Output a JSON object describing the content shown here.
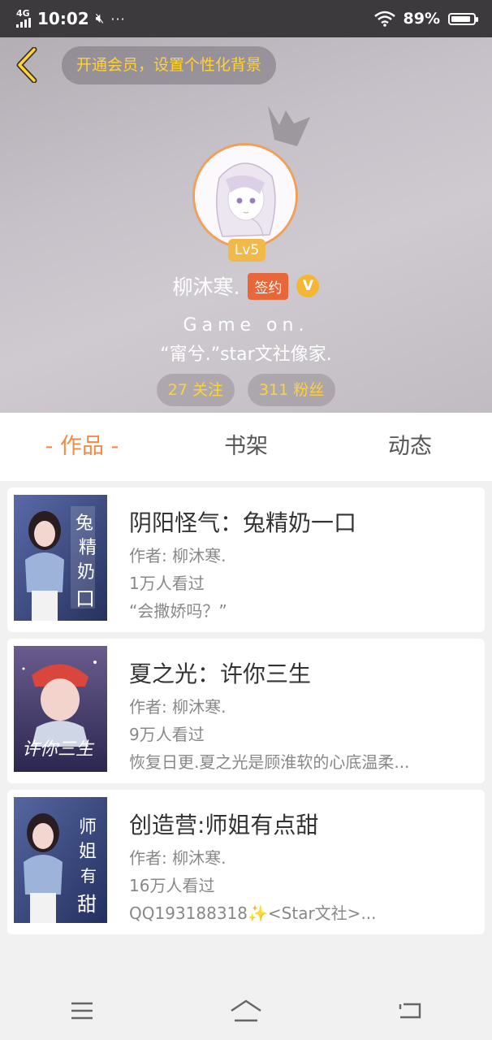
{
  "status_bar": {
    "network": "4G",
    "time": "10:02",
    "battery": "89%",
    "battery_level": 0.89
  },
  "header": {
    "vip_text": "开通会员，设置个性化背景",
    "level": "Lv5",
    "username": "柳沐寒.",
    "sign_badge": "签约",
    "v_badge": "V",
    "bio_line1": "Game on.",
    "bio_line2": "“甯兮.”star文社像家.",
    "following": "27 关注",
    "followers": "311 粉丝"
  },
  "tabs": [
    {
      "label": "- 作品 -",
      "active": true
    },
    {
      "label": "书架",
      "active": false
    },
    {
      "label": "动态",
      "active": false
    }
  ],
  "books": [
    {
      "title": "阴阳怪气：兔精奶一口",
      "author": "作者: 柳沐寒.",
      "views": "1万人看过",
      "desc": "“会撒娇吗？”"
    },
    {
      "title": "夏之光：许你三生",
      "author": "作者: 柳沐寒.",
      "views": "9万人看过",
      "desc": "恢复日更.夏之光是顾淮软的心底温柔..."
    },
    {
      "title": "创造营:师姐有点甜",
      "author": "作者: 柳沐寒.",
      "views": "16万人看过",
      "desc": "QQ193188318✨<Star文社>..."
    }
  ],
  "colors": {
    "accent": "#f08c45",
    "gold": "#ffd23a",
    "sign": "#e8673a"
  }
}
